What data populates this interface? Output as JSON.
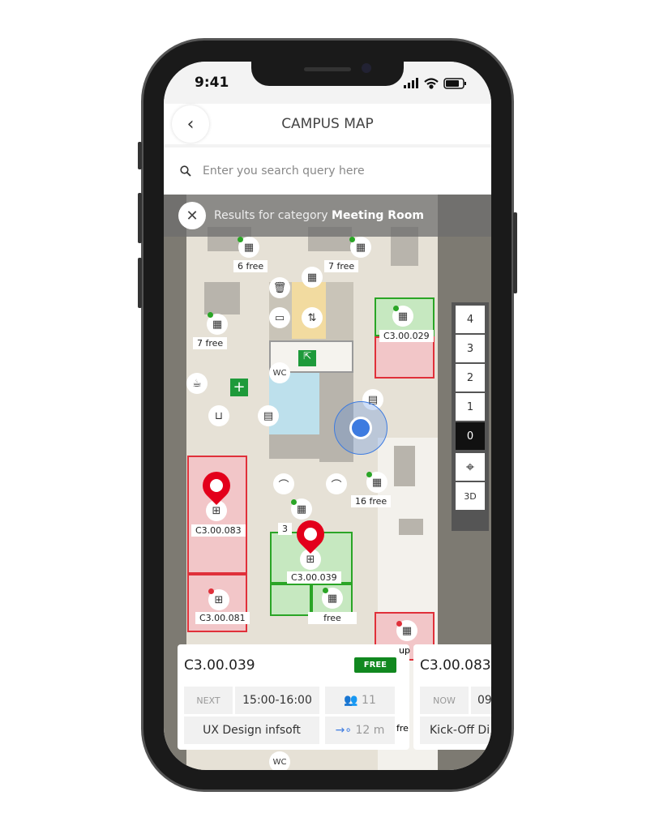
{
  "status_bar": {
    "time": "9:41"
  },
  "header": {
    "title": "CAMPUS MAP",
    "back_icon": "chevron-left-icon"
  },
  "search": {
    "placeholder": "Enter you search query here",
    "value": ""
  },
  "results_banner": {
    "prefix": "Results for category ",
    "category": "Meeting Room"
  },
  "floor_selector": {
    "floors": [
      "4",
      "3",
      "2",
      "1",
      "0"
    ],
    "active": "0",
    "locate_icon": "crosshair-icon",
    "view_3d_label": "3D"
  },
  "map": {
    "labels": [
      "6 free",
      "7 free",
      "7 free",
      "C3.00.029",
      "16 free",
      "C3.00.083",
      "3",
      "C3.00.039",
      "C3.00.081",
      "free",
      "WC",
      "WC",
      "up",
      "fre"
    ],
    "colors": {
      "occupied": "#e0303a",
      "free": "#2aa526",
      "pin": "#e3001b",
      "location": "#3d7be0"
    }
  },
  "cards": [
    {
      "room": "C3.00.039",
      "badge": "FREE",
      "when": "NEXT",
      "time": "15:00-16:00",
      "capacity": "11",
      "event": "UX Design infsoft",
      "distance": "12 m",
      "badge_color": "#11881f"
    },
    {
      "room": "C3.00.083",
      "when": "NOW",
      "time": "09",
      "event": "Kick-Off Di"
    }
  ]
}
